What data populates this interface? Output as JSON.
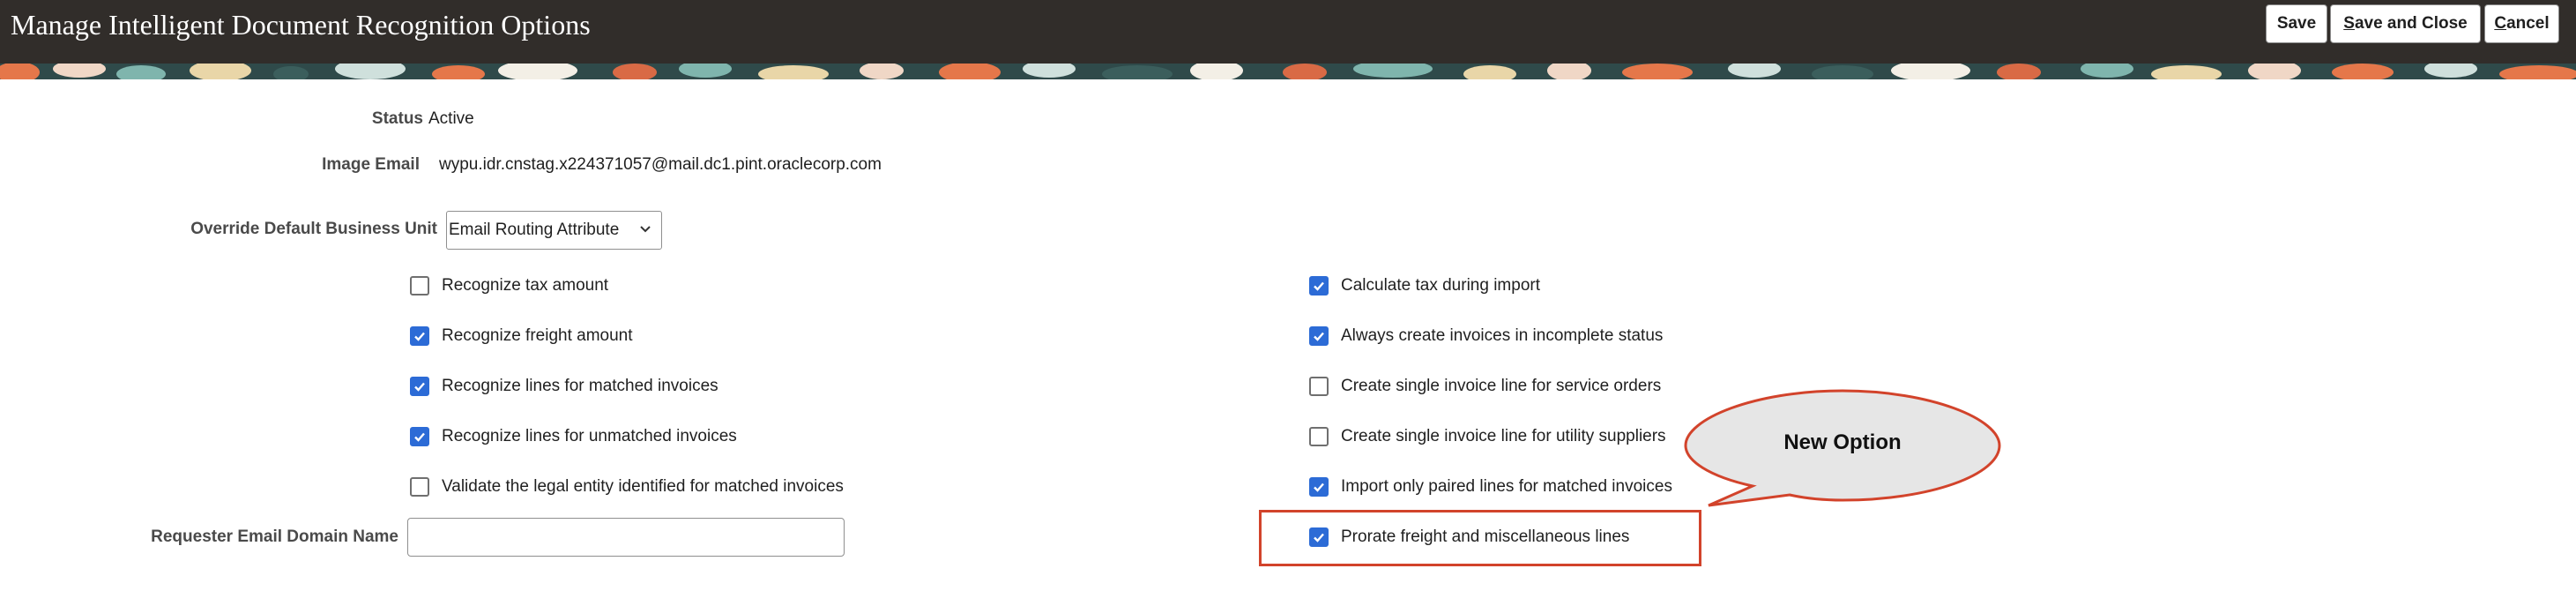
{
  "header": {
    "title": "Manage Intelligent Document Recognition Options",
    "buttons": {
      "save": "Save",
      "save_and_close_first": "S",
      "save_and_close_rest": "ave and Close",
      "cancel_first": "C",
      "cancel_rest": "ancel"
    }
  },
  "form": {
    "status_label": "Status",
    "status_value": "Active",
    "image_email_label": "Image Email",
    "image_email_value": "wypu.idr.cnstag.x224371057@mail.dc1.pint.oraclecorp.com",
    "override_bu_label": "Override Default Business Unit",
    "override_bu_value": "Email Routing Attribute",
    "requester_domain_label": "Requester Email Domain Name",
    "requester_domain_value": ""
  },
  "options_left": [
    {
      "label": "Recognize tax amount",
      "checked": false
    },
    {
      "label": "Recognize freight amount",
      "checked": true
    },
    {
      "label": "Recognize lines for matched invoices",
      "checked": true
    },
    {
      "label": "Recognize lines for unmatched invoices",
      "checked": true
    },
    {
      "label": "Validate the legal entity identified for matched invoices",
      "checked": false
    }
  ],
  "options_right": [
    {
      "label": "Calculate tax during import",
      "checked": true
    },
    {
      "label": "Always create invoices in incomplete status",
      "checked": true
    },
    {
      "label": "Create single invoice line for service orders",
      "checked": false
    },
    {
      "label": "Create single invoice line for utility suppliers",
      "checked": false
    },
    {
      "label": "Import only paired lines for matched invoices",
      "checked": true
    },
    {
      "label": "Prorate freight and miscellaneous lines",
      "checked": true
    }
  ],
  "annotation": {
    "callout_text": "New Option",
    "color": "#d2432b"
  },
  "colors": {
    "header_bg": "#312d2a",
    "checkbox_checked": "#2c6bd6"
  }
}
